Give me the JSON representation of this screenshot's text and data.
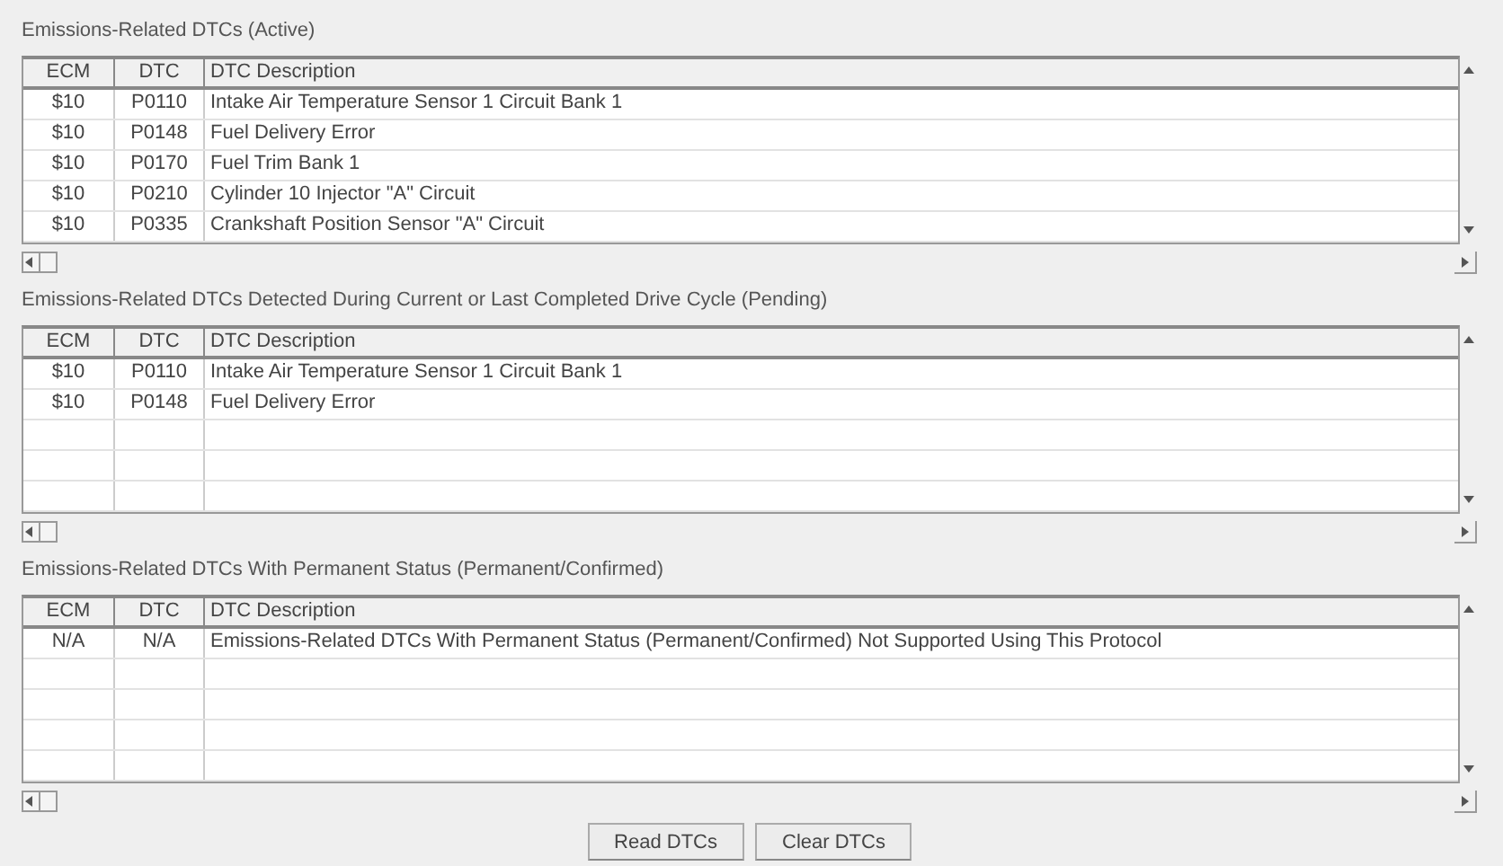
{
  "sections": [
    {
      "title": "Emissions-Related DTCs (Active)",
      "columns": [
        "ECM",
        "DTC",
        "DTC Description"
      ],
      "rows": [
        [
          "$10",
          "P0110",
          "Intake Air Temperature Sensor 1 Circuit Bank 1"
        ],
        [
          "$10",
          "P0148",
          "Fuel Delivery Error"
        ],
        [
          "$10",
          "P0170",
          "Fuel Trim Bank 1"
        ],
        [
          "$10",
          "P0210",
          "Cylinder 10 Injector \"A\" Circuit"
        ],
        [
          "$10",
          "P0335",
          "Crankshaft Position Sensor \"A\" Circuit"
        ]
      ]
    },
    {
      "title": "Emissions-Related DTCs Detected During Current or Last Completed Drive Cycle (Pending)",
      "columns": [
        "ECM",
        "DTC",
        "DTC Description"
      ],
      "rows": [
        [
          "$10",
          "P0110",
          "Intake Air Temperature Sensor 1 Circuit Bank 1"
        ],
        [
          "$10",
          "P0148",
          "Fuel Delivery Error"
        ]
      ]
    },
    {
      "title": "Emissions-Related DTCs With Permanent Status (Permanent/Confirmed)",
      "columns": [
        "ECM",
        "DTC",
        "DTC Description"
      ],
      "rows": [
        [
          "N/A",
          "N/A",
          "Emissions-Related DTCs With Permanent Status (Permanent/Confirmed) Not Supported Using This Protocol"
        ]
      ]
    }
  ],
  "buttons": [
    "Read DTCs",
    "Clear DTCs"
  ]
}
